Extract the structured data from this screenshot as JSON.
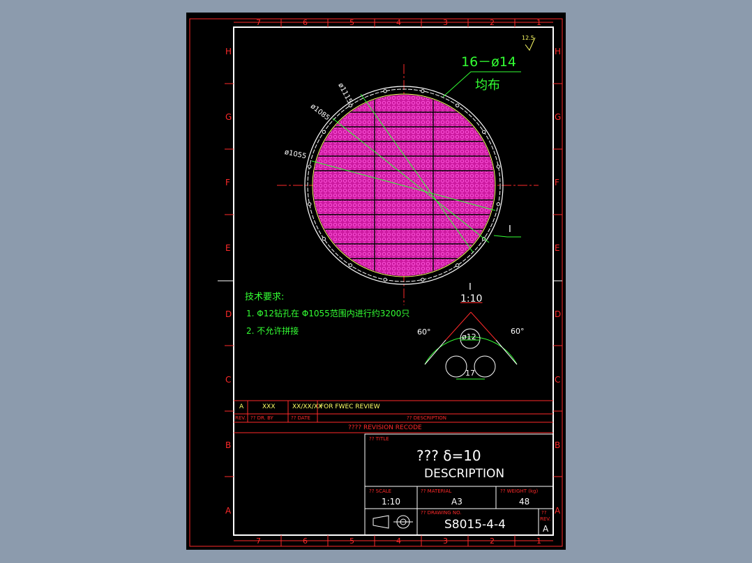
{
  "colors": {
    "background": "#8c9bad",
    "sheet": "#000000",
    "frame": "#ff2a2a",
    "border": "#ffffff",
    "hatch": "#ff33cc",
    "dimension": "#33ff33",
    "text_yellow": "#ffff66"
  },
  "border": {
    "columns": [
      "7",
      "6",
      "5",
      "4",
      "3",
      "2",
      "1"
    ],
    "rows": [
      "H",
      "G",
      "F",
      "E",
      "D",
      "C",
      "B",
      "A"
    ]
  },
  "surface": {
    "roughness": "12.5"
  },
  "annotations": {
    "holes_count": "16－ø14",
    "holes_distribution": "均布",
    "dia_outer": "ø1115",
    "dia_mid": "ø1085",
    "dia_inner": "ø1055",
    "section_mark": "I"
  },
  "detail": {
    "label": "I",
    "scale": "1:10",
    "angle_left": "60°",
    "angle_right": "60°",
    "hole_dia": "ø12",
    "pitch": "17"
  },
  "notes": {
    "title": "技术要求:",
    "item1": "1. Φ12钻孔在 Φ1055范围内进行约3200只",
    "item2": "2. 不允许拼接"
  },
  "revision": {
    "rev": "A",
    "by": "XXX",
    "date": "XX/XX/XX",
    "description": "FOR FWEC REVIEW",
    "hdr_rev": "REV.",
    "hdr_by": "?? DR. BY",
    "hdr_date": "?? DATE",
    "hdr_desc": "?? DESCRIPTION",
    "record": "???? REVISION RECODE"
  },
  "title_block": {
    "title_label": "?? TITLE",
    "title": "??? δ=10",
    "subtitle": "DESCRIPTION",
    "scale_label": "?? SCALE",
    "scale": "1:10",
    "material_label": "?? MATERIAL",
    "material": "A3",
    "weight_label": "?? WEIGHT (kg)",
    "weight": "48",
    "drawing_no_label": "?? DRAWING NO.",
    "drawing_no": "S8015-4-4",
    "rev_label": "??",
    "rev_label2": "REV.",
    "rev": "A"
  }
}
